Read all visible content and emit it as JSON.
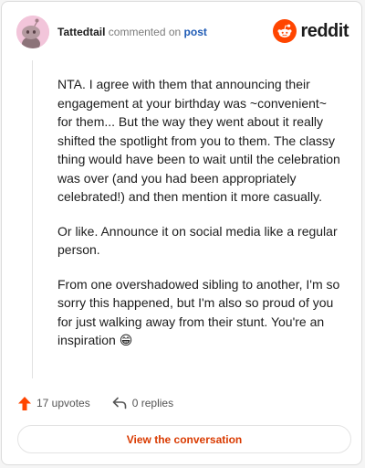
{
  "comment": {
    "author": "Tattedtail",
    "action_text": "commented on",
    "target_link": "post",
    "paragraphs": [
      "NTA. I agree with them that announcing their engagement at your birthday was ~convenient~ for them... But the way they went about it really shifted the spotlight from you to them. The classy thing would have been to wait until the celebration was over (and you had been appropriately celebrated!) and then mention it more casually.",
      "Or like. Announce it on social media like a regular person.",
      "From one overshadowed sibling to another, I'm so sorry this happened, but I'm also so proud of you for just walking away from their stunt. You're an inspiration 😁"
    ],
    "upvotes_label": "17 upvotes",
    "replies_label": "0 replies"
  },
  "brand": {
    "wordmark": "reddit",
    "icon": "reddit-logo-icon"
  },
  "footer": {
    "view_conversation_label": "View the conversation"
  },
  "colors": {
    "brand_orange": "#ff4500",
    "upvote": "#ff4500",
    "link_blue": "#1f5bb5",
    "cta_text": "#d93a00",
    "avatar_bg": "#f2c5da"
  },
  "icons": {
    "avatar": "snoo-avatar-icon",
    "upvote": "upvote-arrow-icon",
    "reply": "reply-arrow-icon"
  }
}
